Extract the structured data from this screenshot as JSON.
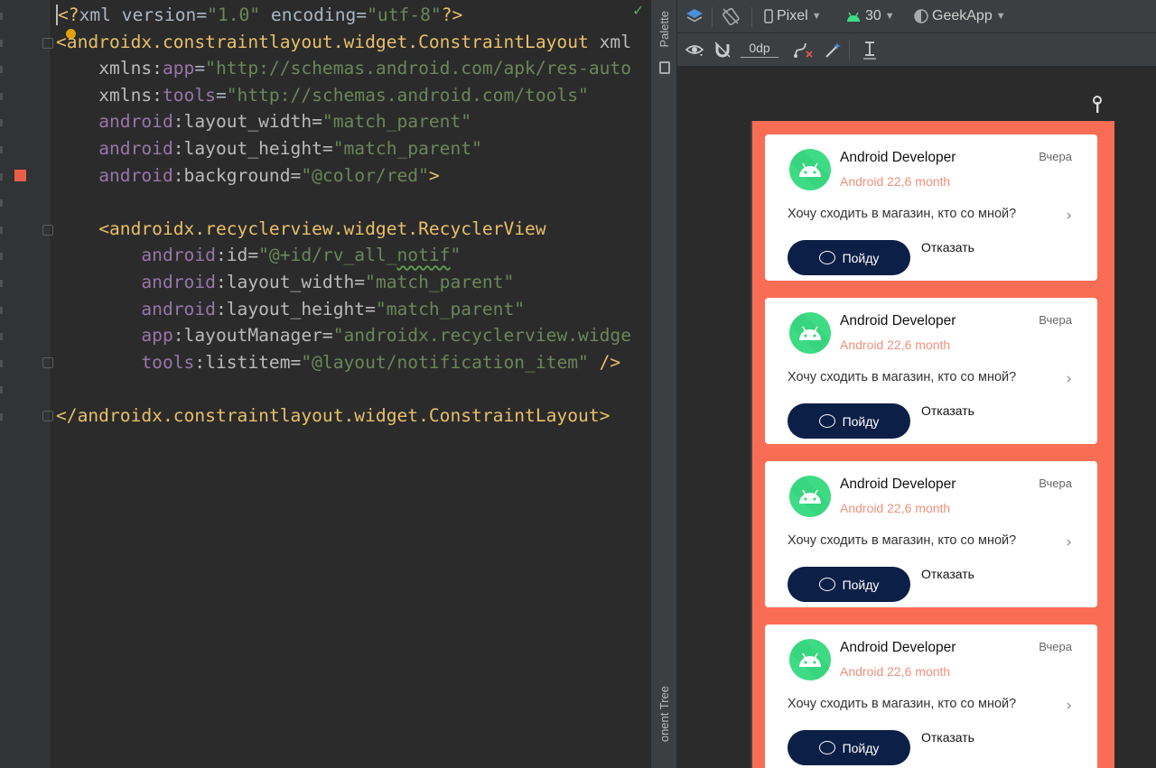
{
  "editor": {
    "code_lines": [
      [
        {
          "t": "<?",
          "c": "tag"
        },
        {
          "t": "xml version=",
          "c": "eq"
        },
        {
          "t": "\"1.0\"",
          "c": "val"
        },
        {
          "t": " encoding=",
          "c": "eq"
        },
        {
          "t": "\"utf-8\"",
          "c": "val"
        },
        {
          "t": "?>",
          "c": "tag"
        }
      ],
      [
        {
          "t": "<androidx.constraintlayout.widget.ConstraintLayout ",
          "c": "tag"
        },
        {
          "t": "xml",
          "c": "attrn"
        }
      ],
      [
        {
          "t": "    ",
          "c": "eq"
        },
        {
          "t": "xmlns:",
          "c": "attrn"
        },
        {
          "t": "app",
          "c": "attr"
        },
        {
          "t": "=",
          "c": "eq"
        },
        {
          "t": "\"http://schemas.android.com/apk/res-auto",
          "c": "val"
        }
      ],
      [
        {
          "t": "    ",
          "c": "eq"
        },
        {
          "t": "xmlns:",
          "c": "attrn"
        },
        {
          "t": "tools",
          "c": "attr"
        },
        {
          "t": "=",
          "c": "eq"
        },
        {
          "t": "\"http://schemas.android.com/tools\"",
          "c": "val"
        }
      ],
      [
        {
          "t": "    ",
          "c": "eq"
        },
        {
          "t": "android",
          "c": "attr"
        },
        {
          "t": ":layout_width=",
          "c": "attrn"
        },
        {
          "t": "\"match_parent\"",
          "c": "val"
        }
      ],
      [
        {
          "t": "    ",
          "c": "eq"
        },
        {
          "t": "android",
          "c": "attr"
        },
        {
          "t": ":layout_height=",
          "c": "attrn"
        },
        {
          "t": "\"match_parent\"",
          "c": "val"
        }
      ],
      [
        {
          "t": "    ",
          "c": "eq"
        },
        {
          "t": "android",
          "c": "attr"
        },
        {
          "t": ":background=",
          "c": "attrn"
        },
        {
          "t": "\"@color/red\"",
          "c": "val"
        },
        {
          "t": ">",
          "c": "tag"
        }
      ],
      [
        {
          "t": "",
          "c": "eq"
        }
      ],
      [
        {
          "t": "    ",
          "c": "eq"
        },
        {
          "t": "<androidx.recyclerview.widget.RecyclerView",
          "c": "tag"
        }
      ],
      [
        {
          "t": "        ",
          "c": "eq"
        },
        {
          "t": "android",
          "c": "attr"
        },
        {
          "t": ":id=",
          "c": "attrn"
        },
        {
          "t": "\"@+id/rv_all_",
          "c": "val"
        },
        {
          "t": "notif",
          "c": "val squig"
        },
        {
          "t": "\"",
          "c": "val"
        }
      ],
      [
        {
          "t": "        ",
          "c": "eq"
        },
        {
          "t": "android",
          "c": "attr"
        },
        {
          "t": ":layout_width=",
          "c": "attrn"
        },
        {
          "t": "\"match_parent\"",
          "c": "val"
        }
      ],
      [
        {
          "t": "        ",
          "c": "eq"
        },
        {
          "t": "android",
          "c": "attr"
        },
        {
          "t": ":layout_height=",
          "c": "attrn"
        },
        {
          "t": "\"match_parent\"",
          "c": "val"
        }
      ],
      [
        {
          "t": "        ",
          "c": "eq"
        },
        {
          "t": "app",
          "c": "attr"
        },
        {
          "t": ":layoutManager=",
          "c": "attrn"
        },
        {
          "t": "\"androidx.recyclerview.widge",
          "c": "val"
        }
      ],
      [
        {
          "t": "        ",
          "c": "eq"
        },
        {
          "t": "tools",
          "c": "attr"
        },
        {
          "t": ":listitem=",
          "c": "attrn"
        },
        {
          "t": "\"@layout/notification_item\"",
          "c": "val"
        },
        {
          "t": " />",
          "c": "tag"
        }
      ],
      [
        {
          "t": "",
          "c": "eq"
        }
      ],
      [
        {
          "t": "</androidx.constraintlayout.widget.ConstraintLayout>",
          "c": "tag"
        }
      ]
    ]
  },
  "side_panel": {
    "palette_label": "Palette",
    "component_tree_label": "onent Tree"
  },
  "toolbar": {
    "device": "Pixel",
    "api_level": "30",
    "theme": "GeekApp",
    "margin_value": "0dp"
  },
  "preview": {
    "colors": {
      "background": "#fa6d55",
      "card": "#ffffff",
      "button": "#0c1f47",
      "subtitle": "#f0907c"
    },
    "cards": [
      {
        "title": "Android Developer",
        "subtitle": "Android 22,6 month",
        "date": "Вчера",
        "message": "Хочу сходить в магазин, кто со мной?",
        "accept": "Пойду",
        "decline": "Отказать"
      },
      {
        "title": "Android Developer",
        "subtitle": "Android 22,6 month",
        "date": "Вчера",
        "message": "Хочу сходить в магазин, кто со мной?",
        "accept": "Пойду",
        "decline": "Отказать"
      },
      {
        "title": "Android Developer",
        "subtitle": "Android 22,6 month",
        "date": "Вчера",
        "message": "Хочу сходить в магазин, кто со мной?",
        "accept": "Пойду",
        "decline": "Отказать"
      },
      {
        "title": "Android Developer",
        "subtitle": "Android 22,6 month",
        "date": "Вчера",
        "message": "Хочу сходить в магазин, кто со мной?",
        "accept": "Пойду",
        "decline": "Отказать"
      }
    ]
  }
}
